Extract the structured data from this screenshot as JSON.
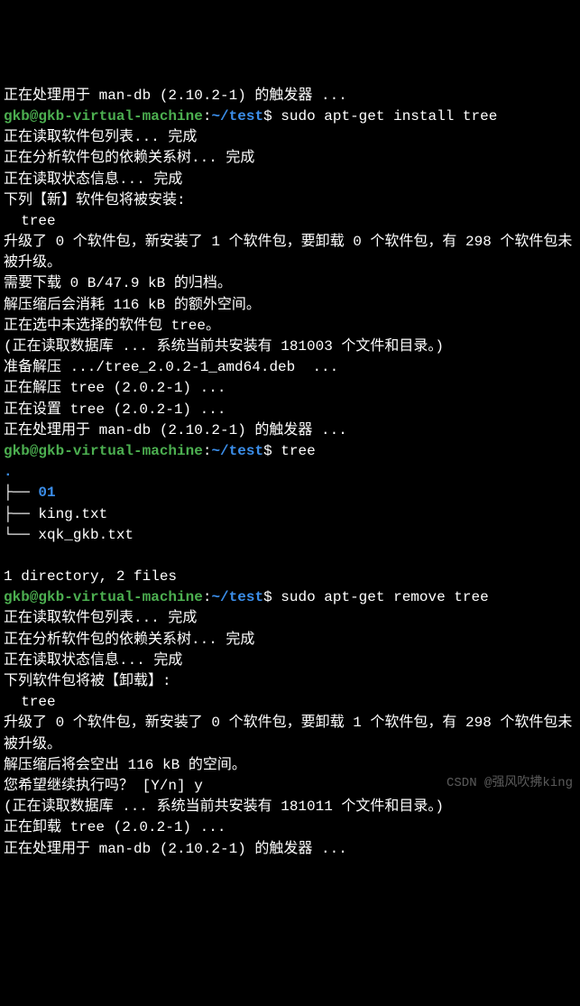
{
  "lines": {
    "l00": "正在处理用于 man-db (2.10.2-1) 的触发器 ...",
    "l01a": "gkb@gkb-virtual-machine",
    "l01b": ":",
    "l01c": "~/test",
    "l01d": "$ sudo apt-get install tree",
    "l02": "正在读取软件包列表... 完成",
    "l03": "正在分析软件包的依赖关系树... 完成",
    "l04": "正在读取状态信息... 完成",
    "l05": "下列【新】软件包将被安装:",
    "l06": "  tree",
    "l07": "升级了 0 个软件包，新安装了 1 个软件包，要卸载 0 个软件包，有 298 个软件包未被升级。",
    "l08": "需要下载 0 B/47.9 kB 的归档。",
    "l09": "解压缩后会消耗 116 kB 的额外空间。",
    "l10": "正在选中未选择的软件包 tree。",
    "l11": "(正在读取数据库 ... 系统当前共安装有 181003 个文件和目录。)",
    "l12": "准备解压 .../tree_2.0.2-1_amd64.deb  ...",
    "l13": "正在解压 tree (2.0.2-1) ...",
    "l14": "正在设置 tree (2.0.2-1) ...",
    "l15": "正在处理用于 man-db (2.10.2-1) 的触发器 ...",
    "l16a": "gkb@gkb-virtual-machine",
    "l16b": ":",
    "l16c": "~/test",
    "l16d": "$ tree",
    "l17": ".",
    "l18a": "├── ",
    "l18b": "01",
    "l19": "├── king.txt",
    "l20": "└── xqk_gkb.txt",
    "l21": "",
    "l22": "1 directory, 2 files",
    "l23a": "gkb@gkb-virtual-machine",
    "l23b": ":",
    "l23c": "~/test",
    "l23d": "$ sudo apt-get remove tree",
    "l24": "正在读取软件包列表... 完成",
    "l25": "正在分析软件包的依赖关系树... 完成",
    "l26": "正在读取状态信息... 完成",
    "l27": "下列软件包将被【卸载】:",
    "l28": "  tree",
    "l29": "升级了 0 个软件包，新安装了 0 个软件包，要卸载 1 个软件包，有 298 个软件包未被升级。",
    "l30": "解压缩后将会空出 116 kB 的空间。",
    "l31": "您希望继续执行吗？ [Y/n] y",
    "l32": "(正在读取数据库 ... 系统当前共安装有 181011 个文件和目录。)",
    "l33": "正在卸载 tree (2.0.2-1) ...",
    "l34": "正在处理用于 man-db (2.10.2-1) 的触发器 ..."
  },
  "watermark": "CSDN @强风吹拂king"
}
